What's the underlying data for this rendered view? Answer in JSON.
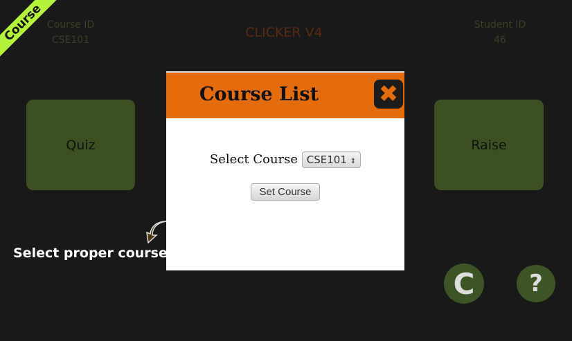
{
  "ribbon": "Course",
  "header": {
    "course_id_label": "Course ID",
    "course_id": "CSE101",
    "title": "CLICKER V4",
    "student_id_label": "Student ID",
    "student_id": "46"
  },
  "buttons": {
    "quiz": "Quiz",
    "raise": "Raise",
    "refresh_icon": "C",
    "help_icon": "?"
  },
  "hint": "Select proper course",
  "modal": {
    "title": "Course List",
    "close_icon": "✖",
    "select_label": "Select Course",
    "selected_course": "CSE101",
    "set_button": "Set Course"
  }
}
